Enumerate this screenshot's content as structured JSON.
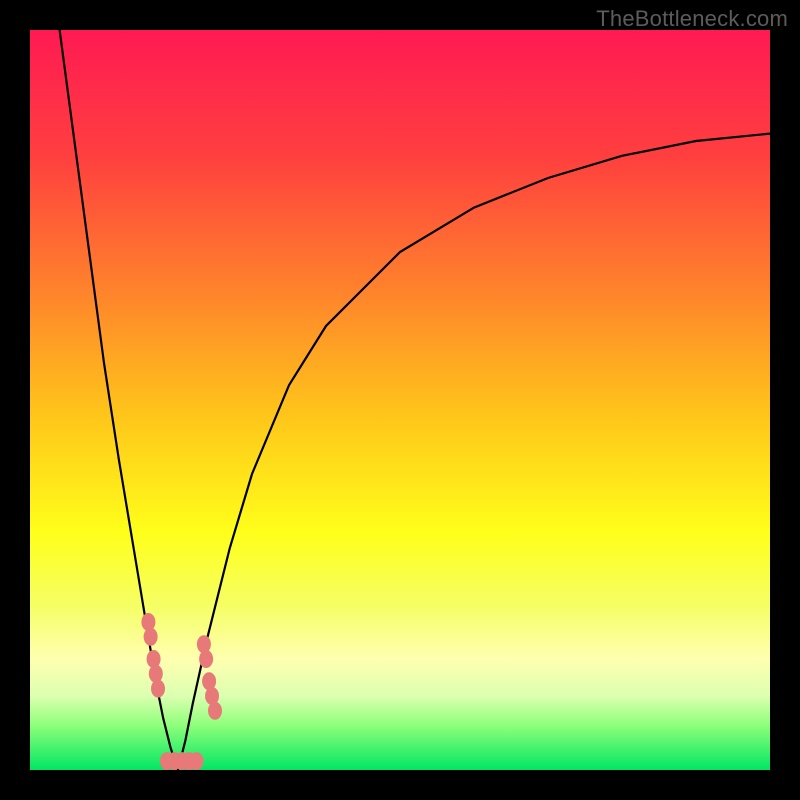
{
  "watermark": "TheBottleneck.com",
  "chart_data": {
    "type": "line",
    "title": "",
    "xlabel": "",
    "ylabel": "",
    "xlim": [
      0,
      100
    ],
    "ylim": [
      0,
      100
    ],
    "grid": false,
    "legend": false,
    "background_gradient": {
      "stops": [
        {
          "offset": 0.0,
          "color": "#ff1a53"
        },
        {
          "offset": 0.17,
          "color": "#ff3f3f"
        },
        {
          "offset": 0.34,
          "color": "#ff7e2d"
        },
        {
          "offset": 0.52,
          "color": "#ffc51a"
        },
        {
          "offset": 0.68,
          "color": "#ffff1a"
        },
        {
          "offset": 0.78,
          "color": "#f5ff66"
        },
        {
          "offset": 0.85,
          "color": "#ffffb0"
        },
        {
          "offset": 0.9,
          "color": "#dcffb0"
        },
        {
          "offset": 0.94,
          "color": "#8dff7a"
        },
        {
          "offset": 1.0,
          "color": "#00e663"
        }
      ]
    },
    "series": [
      {
        "name": "curve-left",
        "x": [
          4,
          6,
          8,
          10,
          12,
          14,
          16,
          17,
          18,
          19,
          20
        ],
        "y": [
          100,
          85,
          70,
          55,
          42,
          30,
          18,
          12,
          7,
          3,
          0
        ]
      },
      {
        "name": "curve-right",
        "x": [
          20,
          21,
          22,
          24,
          27,
          30,
          35,
          40,
          50,
          60,
          70,
          80,
          90,
          100
        ],
        "y": [
          0,
          4,
          9,
          18,
          30,
          40,
          52,
          60,
          70,
          76,
          80,
          83,
          85,
          86
        ]
      }
    ],
    "markers": {
      "name": "highlight-points",
      "color": "#e77a78",
      "points": [
        {
          "x": 16.0,
          "y": 20
        },
        {
          "x": 16.3,
          "y": 18
        },
        {
          "x": 16.7,
          "y": 15
        },
        {
          "x": 17.0,
          "y": 13
        },
        {
          "x": 17.3,
          "y": 11
        },
        {
          "x": 23.5,
          "y": 17
        },
        {
          "x": 23.8,
          "y": 15
        },
        {
          "x": 24.2,
          "y": 12
        },
        {
          "x": 24.6,
          "y": 10
        },
        {
          "x": 25.0,
          "y": 8
        },
        {
          "x": 18.5,
          "y": 1.2
        },
        {
          "x": 19.5,
          "y": 1.2
        },
        {
          "x": 20.5,
          "y": 1.2
        },
        {
          "x": 21.5,
          "y": 1.2
        },
        {
          "x": 22.5,
          "y": 1.2
        }
      ]
    }
  }
}
